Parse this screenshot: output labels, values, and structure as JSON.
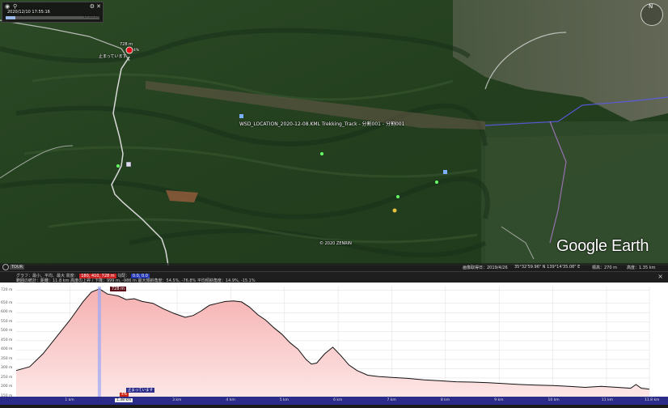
{
  "time_slider": {
    "date_text": "2020/12/10 17:55:16",
    "end_text": "17:55:16"
  },
  "map": {
    "peak_elev": "728 m",
    "peak_label": "止まっています",
    "peak_note": "4%",
    "track_label": "WSD_LOCATION_2020-12-08.KML Trekking_Track - 分割001 - 分割001",
    "copyright": "© 2020 ZENRIN",
    "logo": "Google Earth",
    "nav_north": "N"
  },
  "status_bar": {
    "tour_button": "TOUR",
    "imagery_date": "画像取得日：2019/4/26",
    "coords": "35°32'59.96\" N 139°14'35.08\" E",
    "elev": "標高：270 m",
    "eye_alt": "高度：1.35 km"
  },
  "profile_header": {
    "line1_prefix": "グラフ：最小、平均、最大",
    "line1_elev_label": "高度：",
    "line1_elev_value": "180, 410, 728 m",
    "line1_grade_label": "勾配：",
    "line1_grade_value": "0.0, 0.0",
    "line2": "範囲の統計：距離：11.8 km 高度の上昇 / 下降：999 m, -986 m 最大傾斜角度：54.5%, -76.8% 平均傾斜角度：14.9%, -15.1%",
    "close_icon": "×"
  },
  "profile": {
    "y_ticks": [
      "720 m",
      "650 m",
      "600 m",
      "550 m",
      "500 m",
      "450 m",
      "400 m",
      "350 m",
      "300 m",
      "250 m",
      "200 m",
      "150 m"
    ],
    "x_ticks": [
      "1 km",
      "2 km",
      "3 km",
      "4 km",
      "5 km",
      "6 km",
      "7 km",
      "8 km",
      "9 km",
      "10 km",
      "11 km",
      "11.8 km"
    ],
    "cursor_elev_label": "728 m",
    "cursor_tag": "止まっています",
    "cursor_pct": "4%",
    "cursor_dist": "1.38 km"
  },
  "chart_data": {
    "type": "area",
    "xlabel": "",
    "ylabel": "",
    "x_unit": "km",
    "y_unit": "m",
    "ylim": [
      150,
      740
    ],
    "xlim": [
      0,
      11.8
    ],
    "x": [
      0,
      0.25,
      0.5,
      0.75,
      1.0,
      1.25,
      1.4,
      1.55,
      1.7,
      1.9,
      2.05,
      2.2,
      2.35,
      2.55,
      2.75,
      2.95,
      3.15,
      3.3,
      3.45,
      3.6,
      3.75,
      3.9,
      4.05,
      4.2,
      4.35,
      4.5,
      4.65,
      4.8,
      4.95,
      5.1,
      5.25,
      5.4,
      5.5,
      5.6,
      5.75,
      5.9,
      6.05,
      6.2,
      6.35,
      6.55,
      6.75,
      7.0,
      7.3,
      7.6,
      7.9,
      8.2,
      8.5,
      8.8,
      9.1,
      9.4,
      9.7,
      10.0,
      10.3,
      10.6,
      10.9,
      11.2,
      11.45,
      11.55,
      11.65,
      11.8
    ],
    "values": [
      290,
      310,
      380,
      470,
      560,
      660,
      710,
      728,
      700,
      690,
      670,
      675,
      660,
      650,
      620,
      595,
      575,
      585,
      610,
      640,
      650,
      660,
      663,
      658,
      630,
      590,
      560,
      520,
      485,
      440,
      405,
      350,
      325,
      330,
      380,
      415,
      370,
      320,
      290,
      265,
      258,
      253,
      248,
      240,
      235,
      230,
      228,
      225,
      220,
      215,
      212,
      210,
      205,
      200,
      205,
      200,
      195,
      215,
      195,
      190
    ]
  }
}
